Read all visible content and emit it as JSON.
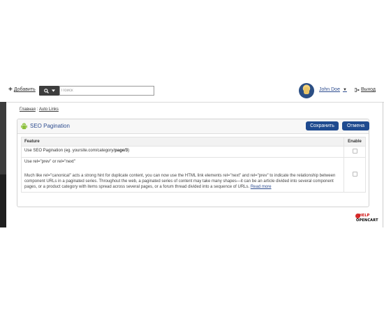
{
  "topbar": {
    "add_label": "Добавить",
    "search_placeholder": "Поиск",
    "user_name": "John Doe",
    "logout_label": "Выход"
  },
  "breadcrumb": {
    "home": "Главная",
    "separator": " : ",
    "current": "Auto Links"
  },
  "panel": {
    "title": "SEO Pagination",
    "save_label": "Сохранить",
    "cancel_label": "Отмена"
  },
  "table": {
    "headers": {
      "feature": "Feature",
      "enable": "Enable"
    },
    "rows": [
      {
        "label_prefix": "Use SEO Pagination (eg. yoursite.com/category/",
        "label_bold": "page/3",
        "label_suffix": ")",
        "enabled": false
      },
      {
        "label": "Use rel=\"prev\" or rel=\"next\"",
        "description": "Much like rel=\"canonical\" acts a strong hint for duplicate content, you can now use the HTML link elements rel=\"next\" and rel=\"prev\" to indicate the relationship between component URLs in a paginated series. Throughout the web, a paginated series of content may take many shapes—it can be an article divided into several component pages, or a product category with items spread across several pages, or a forum thread divided into a sequence of URLs.",
        "read_more": "Read more",
        "enabled": false
      }
    ]
  },
  "logo": {
    "line1": "HELP",
    "line2": "OPENCART"
  },
  "colors": {
    "accent": "#1e4a8f",
    "link": "#2d4c8f",
    "dark_strip": "#1f1f1f"
  },
  "icons": [
    "plus-icon",
    "search-icon",
    "caret-down-icon",
    "logout-icon",
    "android-icon"
  ]
}
